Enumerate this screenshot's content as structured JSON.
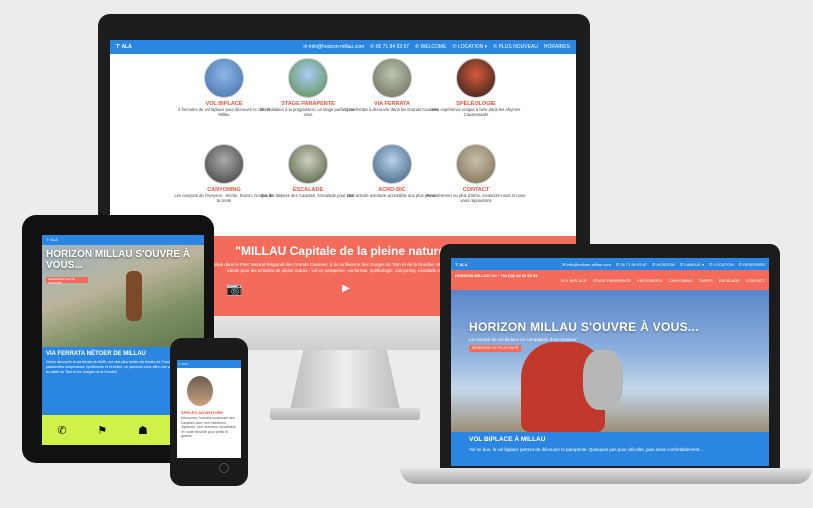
{
  "colors": {
    "blue": "#2a86e0",
    "coral": "#f26b5b",
    "yellow": "#cff24a",
    "accent_text": "#e8533f"
  },
  "desktop": {
    "logo": "T' ALA",
    "nav": [
      "✉ info@horizon-millau.com",
      "✆ 06 71 84 93 67",
      "✆ WELCOME",
      "✆ LOCATION ▾",
      "✆ PLUS NOUVEAU",
      "HORAIRES"
    ],
    "activities": [
      {
        "title": "VOL BIPLACE",
        "desc": "3 formules de vol biplace pour découvrir le ciel de Millau",
        "icon": "paraglider-photo"
      },
      {
        "title": "STAGE PARAPENTE",
        "desc": "De l'initiation à la progression, un stage parfait pour vous",
        "icon": "paraglider-photo"
      },
      {
        "title": "VIA FERRATA",
        "desc": "2 via ferrata à découvrir dans les Grands Causses",
        "icon": "cliff-photo"
      },
      {
        "title": "SPÉLÉOLOGIE",
        "desc": "Une expérience unique à faire dans les Abymes Caussenards",
        "icon": "cave-photo"
      },
      {
        "title": "CANYONING",
        "desc": "Les canyons de l'Aveyron : Sèche, Duzon, Gorges de la Jonte",
        "icon": "canyon-photo"
      },
      {
        "title": "ESCALADE",
        "desc": "Sur les falaises des Causses, l'escalade pour tous",
        "icon": "climbing-photo"
      },
      {
        "title": "ACRO-BIC",
        "desc": "Une activité aventure accessible aux plus jeunes",
        "icon": "acro-photo"
      },
      {
        "title": "CONTACT",
        "desc": "Pour réserver ou plus d'infos, contactez-nous et nous vous répondrons",
        "icon": "contact-photo"
      }
    ],
    "banner_title": "\"MILLAU Capitale de la pleine nature\"",
    "banner_text": "Situé dans le Parc Naturel Régional des Grands Causses, à la confluence des Gorges du Tarn et de la Dourbie, Millau est la destination idéale pour les activités de pleine nature : vol en parapente, via ferrata, spéléologie, canyoning, escalade et acrobranche.",
    "banner_icons": [
      "camera-icon",
      "youtube-icon"
    ]
  },
  "tablet": {
    "logo": "T' ALA",
    "hero_title": "HORIZON MILLAU S'OUVRE À VOUS...",
    "hero_badge": "RÉSERVER CETTE ACTIVITÉ",
    "section_title": "VIA FERRATA NÉTOER DE MILLAU",
    "section_text": "Venez découvrir la via ferrata du Boffi, une des plus belles via ferrata de France. Mêlant passerelles suspendues, tyroliennes et échelles, ce parcours vous offre une vue imprenable sur la vallée du Tarn et les Gorges de la Dourbie.",
    "icons": [
      "phone-icon",
      "sign-icon",
      "shirt-icon",
      "gear-icon"
    ]
  },
  "phone": {
    "logo": "T' ALA",
    "title": "SPÉLÉO ADVENTURE",
    "text": "Découvrez l'univers souterrain des Causses avec nos moniteurs diplômés. Une aventure inoubliable en toute sécurité pour petits et grands."
  },
  "laptop": {
    "logo": "T' ALA",
    "topnav": [
      "✉ info@horizon-millau.com",
      "✆ 06 71 84 93 67",
      "✆ HORIZON",
      "✆ LANGUE ▾",
      "✆ LOCATION",
      "✆ RÉSERVER"
    ],
    "brand": "HORIZON MILLAU  Tél : +33 (0)6 84 94 00 53",
    "menu": [
      "VOL BIPLACE",
      "STAGE PARAPENTE",
      "VIA FERRATA",
      "CANYONING",
      "TARIFS",
      "ESCALADE",
      "CONTACT"
    ],
    "hero_title": "HORIZON MILLAU S'OUVRE À VOUS...",
    "hero_sub": "Le crampe de vol biplace en compagnie d'un moniteur",
    "hero_badge": "RÉSERVER CETTE ACTIVITÉ",
    "section_title": "VOL BIPLACE À MILLAU",
    "section_text": "Vol en duo, le vol biplace permet de découvrir le parapente. Quelques pas pour décoller, puis assis confortablement..."
  }
}
